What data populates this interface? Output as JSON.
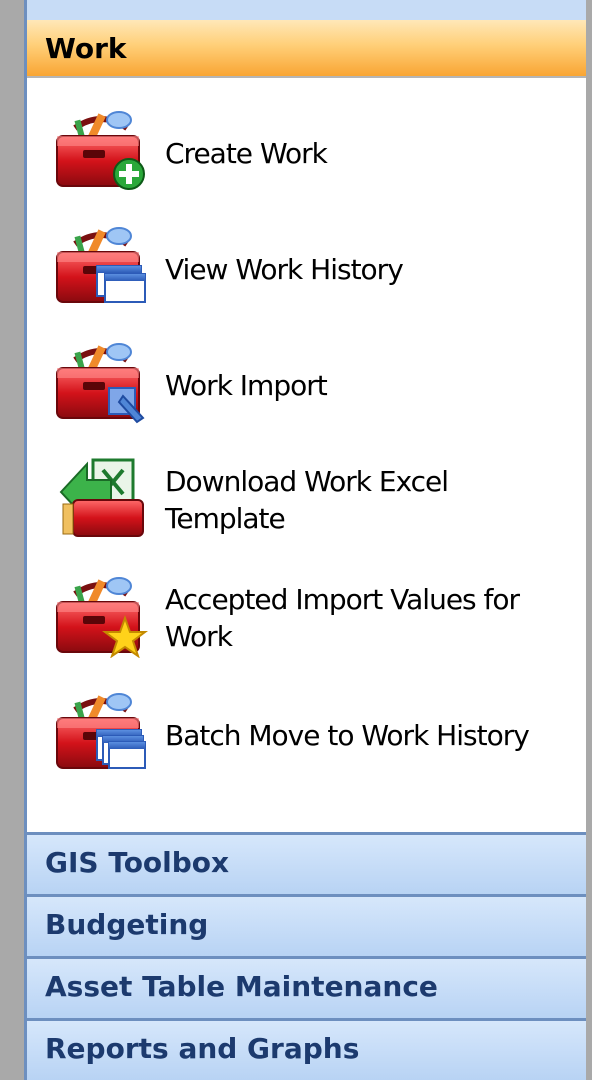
{
  "work_section": {
    "title": "Work",
    "items": [
      {
        "label_line1": "Create Work",
        "label_line2": "",
        "icon": "toolbox-add-icon"
      },
      {
        "label_line1": "View Work History",
        "label_line2": "",
        "icon": "toolbox-history-icon"
      },
      {
        "label_line1": "Work Import",
        "label_line2": "",
        "icon": "toolbox-import-icon"
      },
      {
        "label_line1": "Download Work Excel",
        "label_line2": "Template",
        "icon": "excel-download-icon"
      },
      {
        "label_line1": "Accepted Import Values for",
        "label_line2": "Work",
        "icon": "toolbox-star-icon"
      },
      {
        "label_line1": "Batch Move to Work History",
        "label_line2": "",
        "icon": "toolbox-batch-icon"
      }
    ]
  },
  "collapsed_sections": [
    {
      "title": "GIS Toolbox"
    },
    {
      "title": "Budgeting"
    },
    {
      "title": "Asset Table Maintenance"
    },
    {
      "title": "Reports and Graphs"
    }
  ],
  "colors": {
    "active_header": "#f9a533",
    "collapsed_header": "#b8d3f4",
    "collapsed_text": "#1c3a6e",
    "border": "#6d8fbf"
  }
}
